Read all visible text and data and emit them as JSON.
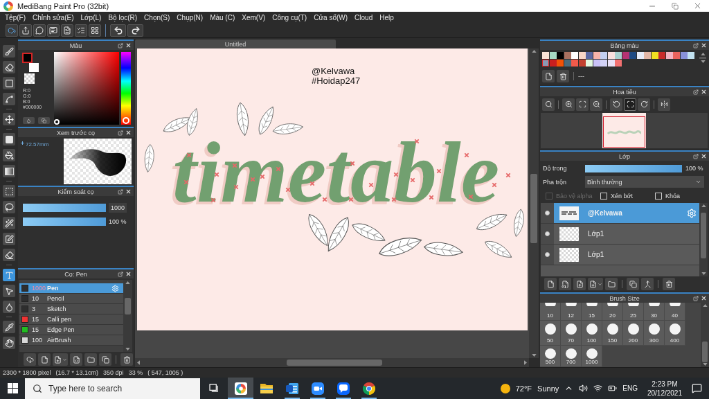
{
  "window": {
    "title": "MediBang Paint Pro (32bit)"
  },
  "menu": [
    "Tệp(F)",
    "Chỉnh sửa(E)",
    "Lớp(L)",
    "Bộ lọc(R)",
    "Chọn(S)",
    "Chụp(N)",
    "Màu (C)",
    "Xem(V)",
    "Công cụ(T)",
    "Cửa sổ(W)",
    "Cloud",
    "Help"
  ],
  "tool_groups": [
    [
      {
        "kind": "brush",
        "selected": false
      },
      {
        "kind": "eraser",
        "selected": false
      },
      {
        "kind": "dot",
        "selected": false
      },
      {
        "kind": "curve",
        "selected": false
      }
    ],
    [
      {
        "kind": "move",
        "selected": false
      }
    ],
    [
      {
        "kind": "fill",
        "selected": false
      },
      {
        "kind": "bucket",
        "selected": false
      },
      {
        "kind": "gradient",
        "selected": false
      }
    ],
    [
      {
        "kind": "select",
        "selected": false
      },
      {
        "kind": "lasso",
        "selected": false
      },
      {
        "kind": "wand",
        "selected": false
      },
      {
        "kind": "selectpen",
        "selected": false
      },
      {
        "kind": "selecteraser",
        "selected": false
      }
    ],
    [
      {
        "kind": "text",
        "selected": true
      },
      {
        "kind": "operation",
        "selected": false
      },
      {
        "kind": "blur",
        "selected": false
      }
    ],
    [
      {
        "kind": "eyedropper",
        "selected": false
      },
      {
        "kind": "hand",
        "selected": false
      }
    ]
  ],
  "color_panel": {
    "title": "Màu",
    "values": [
      "R:0",
      "G:0",
      "B:0",
      "#000000"
    ],
    "hue": {
      "level": 0
    }
  },
  "brush_preview": {
    "title": "Xem trước cọ",
    "size": "72.57mm"
  },
  "brush_control": {
    "title": "Kiểm soát cọ",
    "sliders": [
      {
        "kind": "field",
        "level": 1,
        "reading": "1000"
      },
      {
        "kind": "text",
        "level": 1,
        "reading": "100 %"
      }
    ]
  },
  "brush_list": {
    "title": "Cọ: Pen",
    "items": [
      {
        "size": "1000",
        "name": "Pen",
        "color": "#2e2e2e",
        "selected": true
      },
      {
        "size": "10",
        "name": "Pencil",
        "color": "#2e2e2e",
        "selected": false
      },
      {
        "size": "3",
        "name": "Sketch",
        "color": "#2e2e2e",
        "selected": false
      },
      {
        "size": "15",
        "name": "Calli pen",
        "color": "#ee3333",
        "selected": false
      },
      {
        "size": "15",
        "name": "Edge Pen",
        "color": "#22bb22",
        "selected": false
      },
      {
        "size": "100",
        "name": "AirBrush",
        "color": "#d8d8d8",
        "selected": false
      }
    ]
  },
  "canvas": {
    "tab": "Untitled",
    "texts": [
      "@Kelvawa",
      "#Hoidap247"
    ],
    "lettering": "timetable"
  },
  "palette": {
    "title": "Bảng màu",
    "swatches": [
      {
        "color": "#f9e3d6",
        "selected": false
      },
      {
        "color": "#a6d8c2",
        "selected": false
      },
      {
        "color": "#000000",
        "selected": false
      },
      {
        "color": "#a8705f",
        "selected": false
      },
      {
        "color": "#ffffff",
        "selected": false
      },
      {
        "color": "#f8d6c6",
        "selected": false
      },
      {
        "color": "#5a68a2",
        "selected": false
      },
      {
        "color": "#f6b3aa",
        "selected": false
      },
      {
        "color": "#c3cff0",
        "selected": false
      },
      {
        "color": "#f9e0de",
        "selected": false
      },
      {
        "color": "#a9d1d0",
        "selected": false
      },
      {
        "color": "#b53272",
        "selected": false
      },
      {
        "color": "#1f4a83",
        "selected": false
      },
      {
        "color": "#e7ecf9",
        "selected": false
      },
      {
        "color": "#e2b6a6",
        "selected": false
      },
      {
        "color": "#f0e021",
        "selected": false
      },
      {
        "color": "#c82a2a",
        "selected": false
      },
      {
        "color": "#f2b2c2",
        "selected": false
      },
      {
        "color": "#e8625d",
        "selected": false
      },
      {
        "color": "#8891d9",
        "selected": false
      },
      {
        "color": "#c2e2f1",
        "selected": false
      },
      {
        "color": "#8a9ab3",
        "selected": true
      },
      {
        "color": "#c91f1f",
        "selected": false
      },
      {
        "color": "#f25207",
        "selected": false
      },
      {
        "color": "#4a6a7a",
        "selected": false
      },
      {
        "color": "#f25a4a",
        "selected": false
      },
      {
        "color": "#c2412f",
        "selected": false
      },
      {
        "color": "#e2f7df",
        "selected": false
      },
      {
        "color": "#c9c1f7",
        "selected": false
      },
      {
        "color": "#d2d2f6",
        "selected": false
      },
      {
        "color": "#e9e1f6",
        "selected": false
      },
      {
        "color": "#f27171",
        "selected": false
      }
    ],
    "set_name": "---"
  },
  "navigator": {
    "title": "Hoa tiêu",
    "tool_groups": [
      [
        {
          "kind": "actual",
          "selected": false
        }
      ],
      [
        {
          "kind": "zoomin",
          "selected": false
        },
        {
          "kind": "fit",
          "selected": false
        },
        {
          "kind": "zoomout",
          "selected": false
        }
      ],
      [
        {
          "kind": "rotateleft",
          "selected": false
        },
        {
          "kind": "center",
          "selected": true
        },
        {
          "kind": "rotateright",
          "selected": false
        }
      ],
      [
        {
          "kind": "flip",
          "selected": false
        }
      ]
    ]
  },
  "layers": {
    "title": "Lớp",
    "opacity": {
      "label": "Độ trong",
      "level": 1,
      "reading": "100 %"
    },
    "blend": {
      "label": "Pha trộn",
      "value": "Bình thường"
    },
    "options": [
      {
        "label": "Bảo vệ alpha",
        "checked": false,
        "disabled": true
      },
      {
        "label": "Xén bớt",
        "checked": false,
        "disabled": false
      },
      {
        "label": "Khóa",
        "checked": false,
        "disabled": false
      }
    ],
    "items": [
      {
        "name": "@Kelvawa",
        "kind": "text",
        "visible": true,
        "selected": true
      },
      {
        "name": "Lớp1",
        "kind": "raster",
        "visible": true,
        "selected": false
      },
      {
        "name": "Lớp1",
        "kind": "raster",
        "visible": true,
        "selected": false
      }
    ]
  },
  "brush_size": {
    "title": "Brush Size",
    "rows": [
      {
        "partial": true,
        "sizes": [
          "10",
          "12",
          "15",
          "20",
          "25",
          "30",
          "40"
        ]
      },
      {
        "partial": false,
        "sizes": [
          "50",
          "70",
          "100",
          "150",
          "200",
          "300",
          "400"
        ]
      },
      {
        "partial": false,
        "sizes": [
          "500",
          "700",
          "1000"
        ]
      }
    ]
  },
  "status_bar": [
    "2300 * 1800 pixel",
    "(16.7 * 13.1cm)",
    "350 dpi",
    "33 %",
    "( 547, 1005 )"
  ],
  "taskbar": {
    "search": {
      "placeholder": "Type here to search"
    },
    "apps": [
      {
        "kind": "medibang",
        "selected": true,
        "running": true
      },
      {
        "kind": "explorer",
        "selected": false,
        "running": false
      },
      {
        "kind": "word",
        "selected": false,
        "running": true
      },
      {
        "kind": "zoom",
        "selected": false,
        "running": true
      },
      {
        "kind": "zalo",
        "selected": false,
        "running": true
      },
      {
        "kind": "chrome",
        "selected": false,
        "running": true
      }
    ],
    "weather": {
      "temperature": "72°F",
      "condition": "Sunny"
    },
    "language": "ENG",
    "time": "2:23 PM",
    "date": "20/12/2021"
  }
}
